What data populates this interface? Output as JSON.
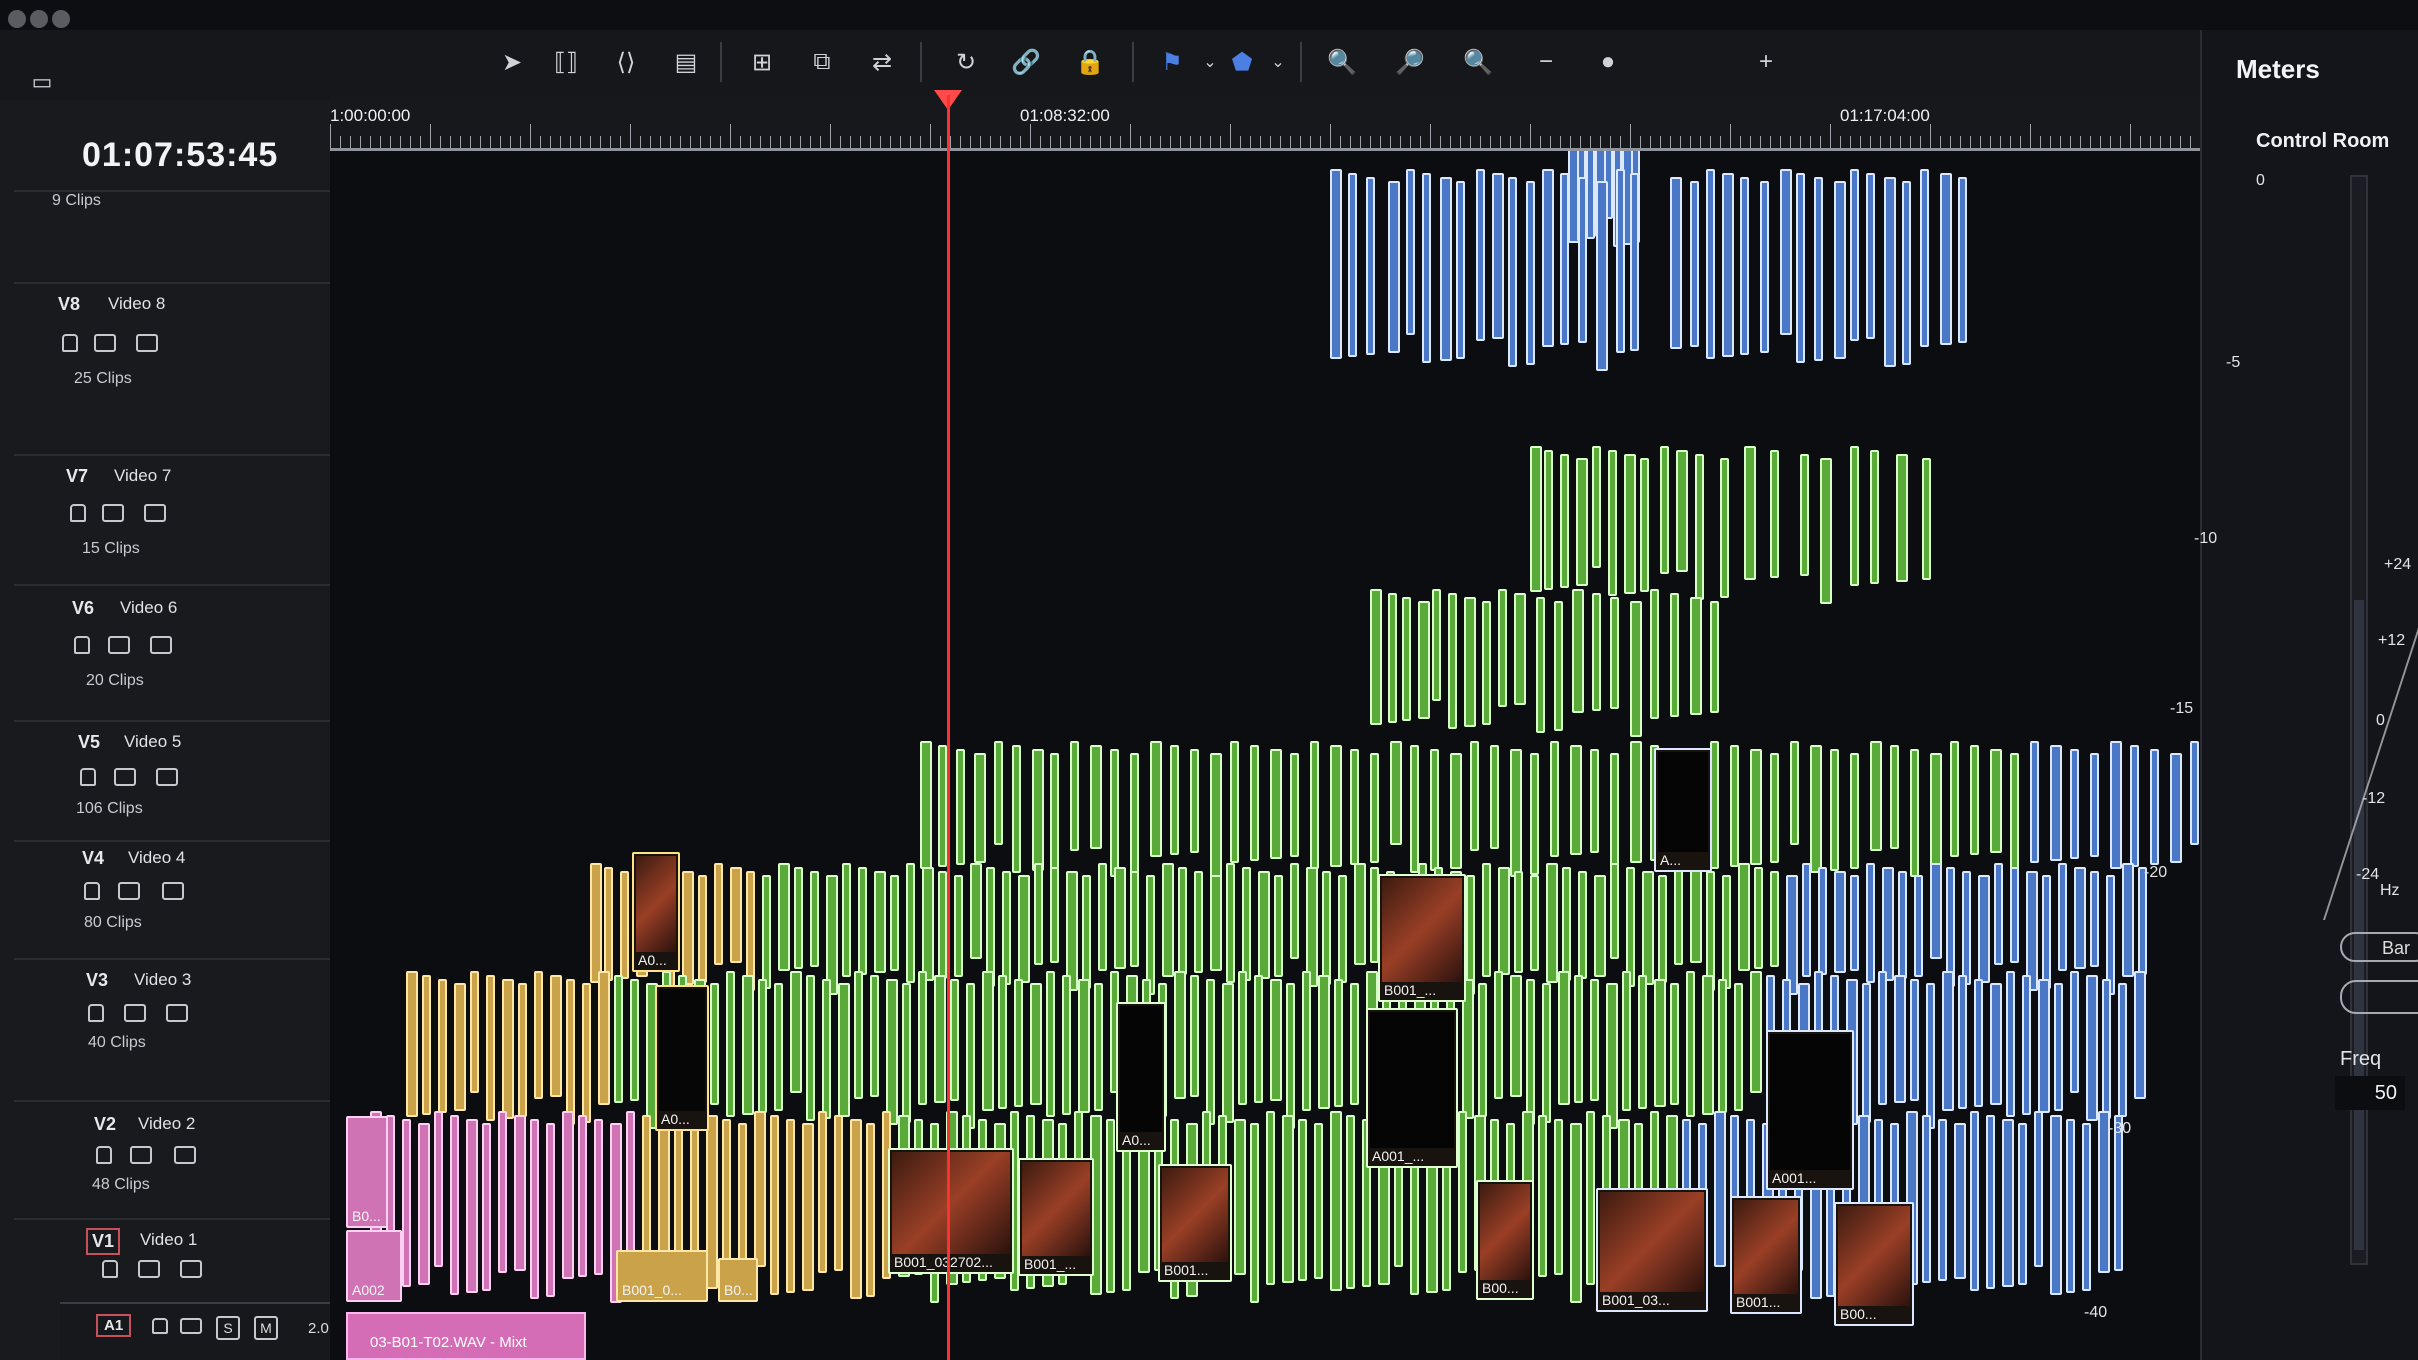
{
  "window": {
    "meters_title": "Meters",
    "meters_subtitle": "Control Room"
  },
  "timecode": "01:07:53:45",
  "ruler": {
    "labels": [
      "1:00:00:00",
      "01:08:32:00",
      "01:17:04:00"
    ]
  },
  "tracks": [
    {
      "id": "",
      "name": "",
      "clips": "9 Clips"
    },
    {
      "id": "V8",
      "name": "Video 8",
      "clips": "25 Clips"
    },
    {
      "id": "V7",
      "name": "Video 7",
      "clips": "15 Clips"
    },
    {
      "id": "V6",
      "name": "Video 6",
      "clips": "20 Clips"
    },
    {
      "id": "V5",
      "name": "Video 5",
      "clips": "106 Clips"
    },
    {
      "id": "V4",
      "name": "Video 4",
      "clips": "80 Clips"
    },
    {
      "id": "V3",
      "name": "Video 3",
      "clips": "40 Clips"
    },
    {
      "id": "V2",
      "name": "Video 2",
      "clips": "48 Clips"
    },
    {
      "id": "V1",
      "name": "Video 1",
      "clips": ""
    },
    {
      "id": "A1",
      "name": "",
      "clips": "",
      "audio_controls": [
        "S",
        "M"
      ],
      "level": "2.0"
    }
  ],
  "clip_labels": [
    "B0...",
    "A002",
    "A0...",
    "A0...",
    "B001_0...",
    "B0...",
    "B001_032702...",
    "B001_...",
    "B001...",
    "A0...",
    "B001_...",
    "A001_...",
    "B00...",
    "B001_03...",
    "B001...",
    "B00...",
    "A...",
    "A001..."
  ],
  "audio_clip": "03-B01-T02.WAV - Mixt",
  "meters": {
    "left_scale": [
      "0",
      "-5",
      "-10",
      "-15",
      "-20",
      "-30",
      "-40"
    ],
    "right_scale": [
      "+24",
      "+12",
      "0",
      "-12",
      "-24"
    ],
    "unit": "Hz",
    "buttons": [
      "Bar"
    ],
    "freq_label": "Freq",
    "freq_value": "50"
  },
  "colors": {
    "green": "#5aaa3a",
    "blue": "#4a78c6",
    "yellow": "#c9a24a",
    "pink": "#cf73b5",
    "playhead": "#ff3030"
  }
}
